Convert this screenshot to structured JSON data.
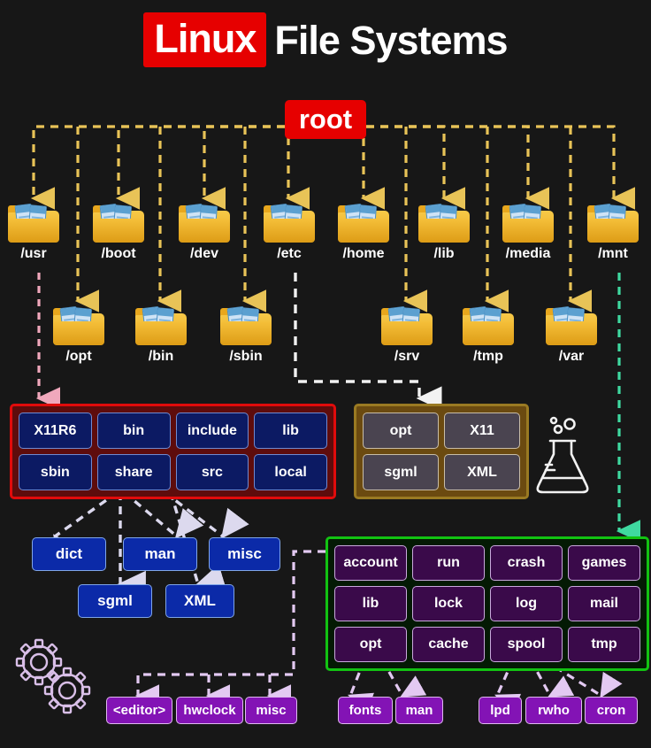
{
  "title": {
    "highlight": "Linux",
    "rest": "File Systems"
  },
  "root": {
    "label": "root"
  },
  "folders_row1": [
    {
      "label": "/usr"
    },
    {
      "label": "/boot"
    },
    {
      "label": "/dev"
    },
    {
      "label": "/etc"
    },
    {
      "label": "/home"
    },
    {
      "label": "/lib"
    },
    {
      "label": "/media"
    },
    {
      "label": "/mnt"
    }
  ],
  "folders_row2": [
    {
      "label": "/opt"
    },
    {
      "label": "/bin"
    },
    {
      "label": "/sbin"
    },
    {
      "label": "/srv"
    },
    {
      "label": "/tmp"
    },
    {
      "label": "/var"
    }
  ],
  "usr_panel": {
    "source": "/usr",
    "items": [
      "X11R6",
      "bin",
      "include",
      "lib",
      "sbin",
      "share",
      "src",
      "local"
    ]
  },
  "etc_panel": {
    "source": "/etc",
    "items": [
      "opt",
      "X11",
      "sgml",
      "XML"
    ]
  },
  "var_panel": {
    "source": "/var",
    "items": [
      "account",
      "run",
      "crash",
      "games",
      "lib",
      "lock",
      "log",
      "mail",
      "opt",
      "cache",
      "spool",
      "tmp"
    ]
  },
  "share_children": [
    "dict",
    "man",
    "misc"
  ],
  "share_grandchildren": [
    "sgml",
    "XML"
  ],
  "var_opt_children": [
    "fonts",
    "man"
  ],
  "var_spool_children": [
    "lpd",
    "rwho",
    "cron"
  ],
  "var_account_children": [
    "<editor>",
    "hwclock",
    "misc"
  ],
  "icons": {
    "flask": "flask-icon",
    "gears": "gears-icon",
    "folder": "folder-icon"
  },
  "colors": {
    "background": "#171717",
    "accent_red": "#e60000",
    "wire_yellow": "#e8c357",
    "wire_pink": "#f0a8bc",
    "wire_white": "#f2f2f2",
    "wire_green": "#3fd9a0",
    "wire_lavender": "#e3c9f2",
    "panel_usr_border": "#e10b0b",
    "panel_etc_border": "#9a7a22",
    "panel_var_border": "#12c312",
    "chip_blue": "#0c1a63",
    "chip_gray": "#4a4450",
    "chip_purple": "#3a0a4a",
    "box_blue": "#0b2aa8",
    "box_purple": "#8313b5"
  }
}
